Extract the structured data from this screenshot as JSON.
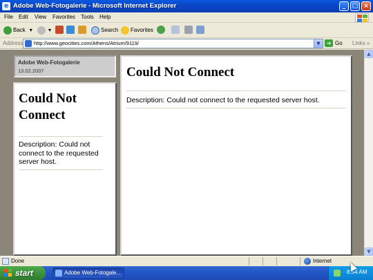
{
  "window": {
    "title": "Adobe Web-Fotogalerie - Microsoft Internet Explorer"
  },
  "menu": [
    "File",
    "Edit",
    "View",
    "Favorites",
    "Tools",
    "Help"
  ],
  "toolbar": {
    "back": "Back",
    "search": "Search",
    "favorites": "Favorites"
  },
  "address": {
    "label": "Address",
    "url": "http://www.geocities.com/Athens/Atrium/9119/",
    "go": "Go",
    "links": "Links"
  },
  "gallery": {
    "title": "Adobe Web-Fotogalerie",
    "date": "13.02.2007"
  },
  "left_frame": {
    "heading": "Could Not Connect",
    "description": "Description: Could not connect to the requested server host."
  },
  "main_frame": {
    "heading": "Could Not Connect",
    "description": "Description: Could not connect to the requested server host."
  },
  "status": {
    "text": "Done",
    "zone": "Internet"
  },
  "taskbar": {
    "start": "start",
    "task": "Adobe Web-Fotogale...",
    "clock": "8:54 AM"
  },
  "colors": {
    "title_bar": "#0a46c8",
    "frame_bg": "#8c8679",
    "start_green": "#3a8f3a"
  }
}
